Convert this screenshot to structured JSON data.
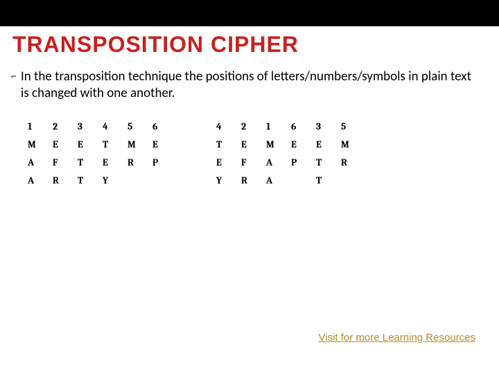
{
  "title": "TRANSPOSITION CIPHER",
  "bullet": "In the transposition technique the positions of letters/numbers/symbols in plain text is changed with one another.",
  "table_left": [
    [
      "1",
      "2",
      "3",
      "4",
      "5",
      "6"
    ],
    [
      "M",
      "E",
      "E",
      "T",
      "M",
      "E"
    ],
    [
      "A",
      "F",
      "T",
      "E",
      "R",
      "P"
    ],
    [
      "A",
      "R",
      "T",
      "Y",
      "",
      ""
    ]
  ],
  "table_right": [
    [
      "4",
      "2",
      "1",
      "6",
      "3",
      "5"
    ],
    [
      "T",
      "E",
      "M",
      "E",
      "E",
      "M"
    ],
    [
      "E",
      "F",
      "A",
      "P",
      "T",
      "R"
    ],
    [
      "Y",
      "R",
      "A",
      "",
      "T",
      ""
    ]
  ],
  "footer": "Visit for more Learning Resources"
}
